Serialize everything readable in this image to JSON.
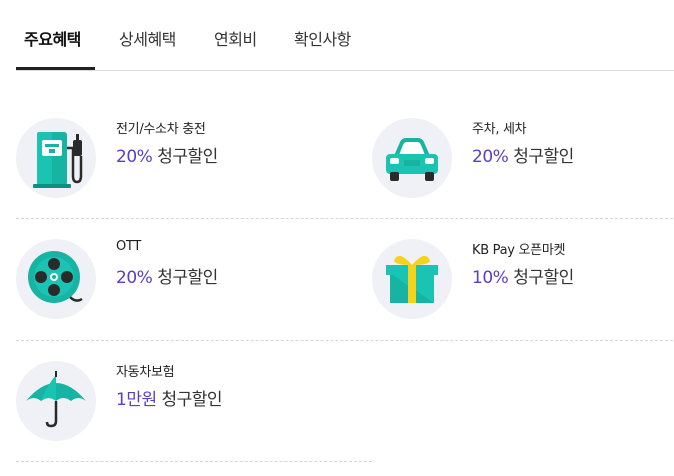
{
  "tabs": [
    {
      "label": "주요혜택",
      "active": true
    },
    {
      "label": "상세혜택",
      "active": false
    },
    {
      "label": "연회비",
      "active": false
    },
    {
      "label": "확인사항",
      "active": false
    }
  ],
  "benefits": [
    {
      "title": "전기/수소차 충전",
      "rate": "20%",
      "label": "청구할인",
      "icon": "ev-charger-icon"
    },
    {
      "title": "주차, 세차",
      "rate": "20%",
      "label": "청구할인",
      "icon": "car-icon"
    },
    {
      "title": "OTT",
      "rate": "20%",
      "label": "청구할인",
      "icon": "film-reel-icon"
    },
    {
      "title": "KB Pay 오픈마켓",
      "rate": "10%",
      "label": "청구할인",
      "icon": "gift-box-icon"
    },
    {
      "title": "자동차보험",
      "rate": "1만원",
      "label": "청구할인",
      "icon": "umbrella-icon"
    }
  ],
  "colors": {
    "accent": "#5a3fc0",
    "icon_teal": "#17b3a3",
    "icon_bg": "#f0f1f6",
    "tab_underline": "#222222"
  }
}
